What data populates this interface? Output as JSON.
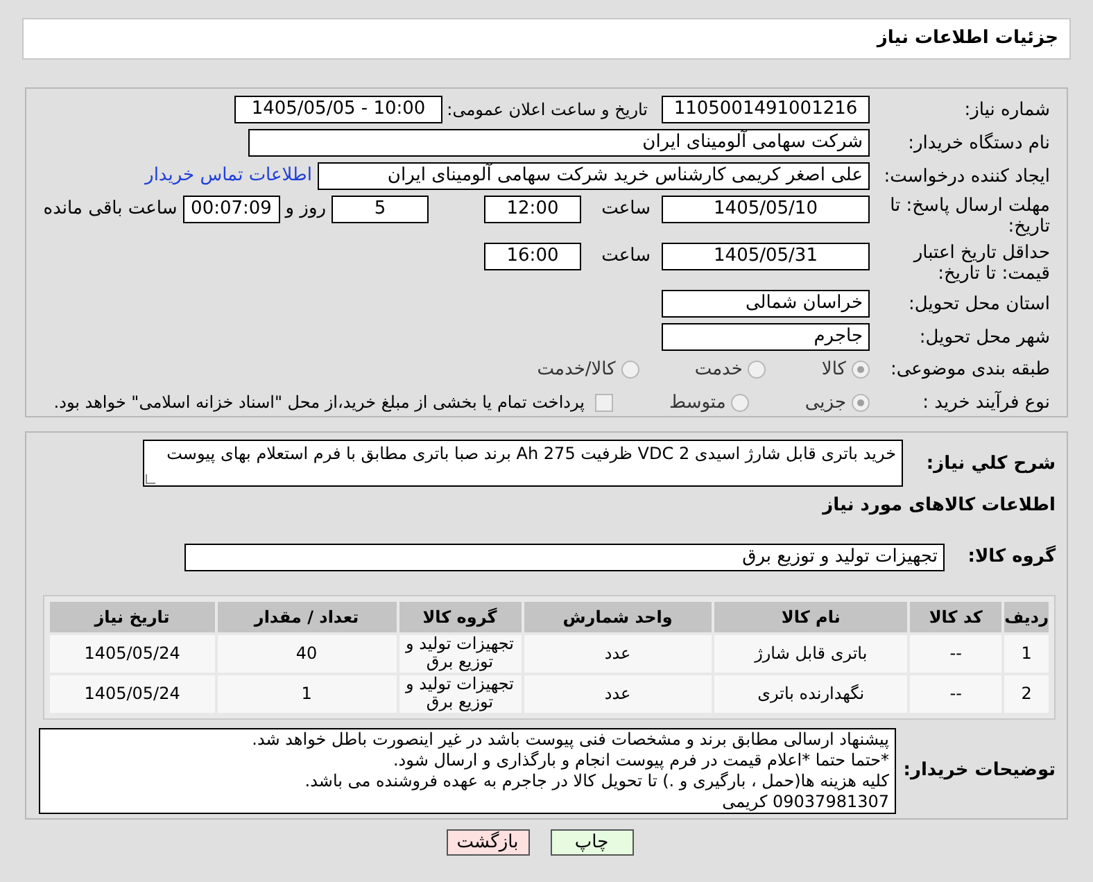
{
  "header": {
    "title": "جزئیات اطلاعات نیاز"
  },
  "need_number": {
    "label": "شماره نیاز:",
    "value": "1105001491001216"
  },
  "announce": {
    "label": "تاریخ و ساعت اعلان عمومی:",
    "value": "1405/05/05 - 10:00"
  },
  "buyer_org": {
    "label": "نام دستگاه خریدار:",
    "value": "شرکت سهامی آلومینای ایران"
  },
  "requester": {
    "label": "ایجاد کننده درخواست:",
    "value": "علی اصغر کریمی کارشناس خرید شرکت سهامی آلومینای ایران",
    "link": "اطلاعات تماس خریدار"
  },
  "deadline": {
    "label": "مهلت ارسال پاسخ: تا تاریخ:",
    "date": "1405/05/10",
    "time_label": "ساعت",
    "time": "12:00",
    "days": "5",
    "days_label": "روز و",
    "remaining": "00:07:09",
    "remaining_label": "ساعت باقی مانده"
  },
  "validity": {
    "label": "حداقل تاریخ اعتبار قیمت: تا تاریخ:",
    "date": "1405/05/31",
    "time_label": "ساعت",
    "time": "16:00"
  },
  "province": {
    "label": "استان محل تحویل:",
    "value": "خراسان شمالی"
  },
  "city": {
    "label": "شهر محل تحویل:",
    "value": "جاجرم"
  },
  "category": {
    "label": "طبقه بندی موضوعی:",
    "options": [
      {
        "label": "کالا",
        "selected": true
      },
      {
        "label": "خدمت",
        "selected": false
      },
      {
        "label": "کالا/خدمت",
        "selected": false
      }
    ]
  },
  "process": {
    "label": "نوع فرآیند خرید :",
    "options": [
      {
        "label": "جزیی",
        "selected": true
      },
      {
        "label": "متوسط",
        "selected": false
      }
    ],
    "payment": {
      "label": "پرداخت تمام یا بخشی از مبلغ خرید،از محل \"اسناد خزانه اسلامی\" خواهد بود.",
      "checked": false
    }
  },
  "summary": {
    "label": "شرح کلي نياز:",
    "value": "خرید باتری قابل شارژ اسیدی 2 VDC ظرفیت 275 Ah برند صبا باتری مطابق با فرم استعلام بهای پیوست"
  },
  "goods_title": "اطلاعات کالاهای مورد نیاز",
  "goods_group": {
    "label": "گروه کالا:",
    "value": "تجهیزات تولید و توزیع برق"
  },
  "table": {
    "columns": [
      "ردیف",
      "کد کالا",
      "نام کالا",
      "واحد شمارش",
      "گروه کالا",
      "تعداد / مقدار",
      "تاریخ نیاز"
    ],
    "rows": [
      [
        "1",
        "--",
        "باتری قابل شارژ",
        "عدد",
        "تجهیزات تولید و توزیع برق",
        "40",
        "1405/05/24"
      ],
      [
        "2",
        "--",
        "نگهدارنده باتری",
        "عدد",
        "تجهیزات تولید و توزیع برق",
        "1",
        "1405/05/24"
      ]
    ]
  },
  "buyer_notes": {
    "label": "توضیحات خریدار:",
    "value": "پیشنهاد ارسالی مطابق برند و مشخصات فنی پیوست باشد در غیر اینصورت باطل خواهد شد.\n*حتما حتما *اعلام قیمت در فرم پیوست انجام و بارگذاری و ارسال شود.\nکلیه هزینه ها(حمل ، بارگیری و .) تا تحویل کالا در جاجرم به عهده فروشنده می باشد.\n09037981307 کریمی"
  },
  "buttons": [
    {
      "label": "چاپ",
      "kind": "print"
    },
    {
      "label": "بازگشت",
      "kind": "back"
    }
  ]
}
